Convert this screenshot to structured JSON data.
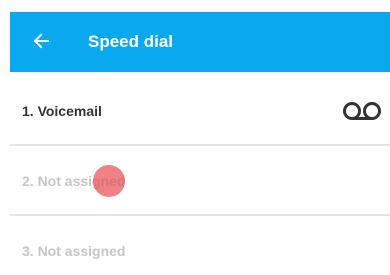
{
  "header": {
    "back_icon": "arrow-left-icon",
    "title": "Speed dial",
    "background_color": "#0aa8ef"
  },
  "speed_dial": {
    "items": [
      {
        "label": "1. Voicemail",
        "icon": "voicemail-icon",
        "state": "assigned"
      },
      {
        "label": "2. Not assigned",
        "state": "unassigned"
      },
      {
        "label": "3. Not assigned",
        "state": "unassigned"
      }
    ]
  },
  "colors": {
    "active_text": "#333333",
    "inactive_text": "#c6c6c6",
    "divider": "#e6e6e6",
    "touch_indicator": "#e84c50"
  }
}
